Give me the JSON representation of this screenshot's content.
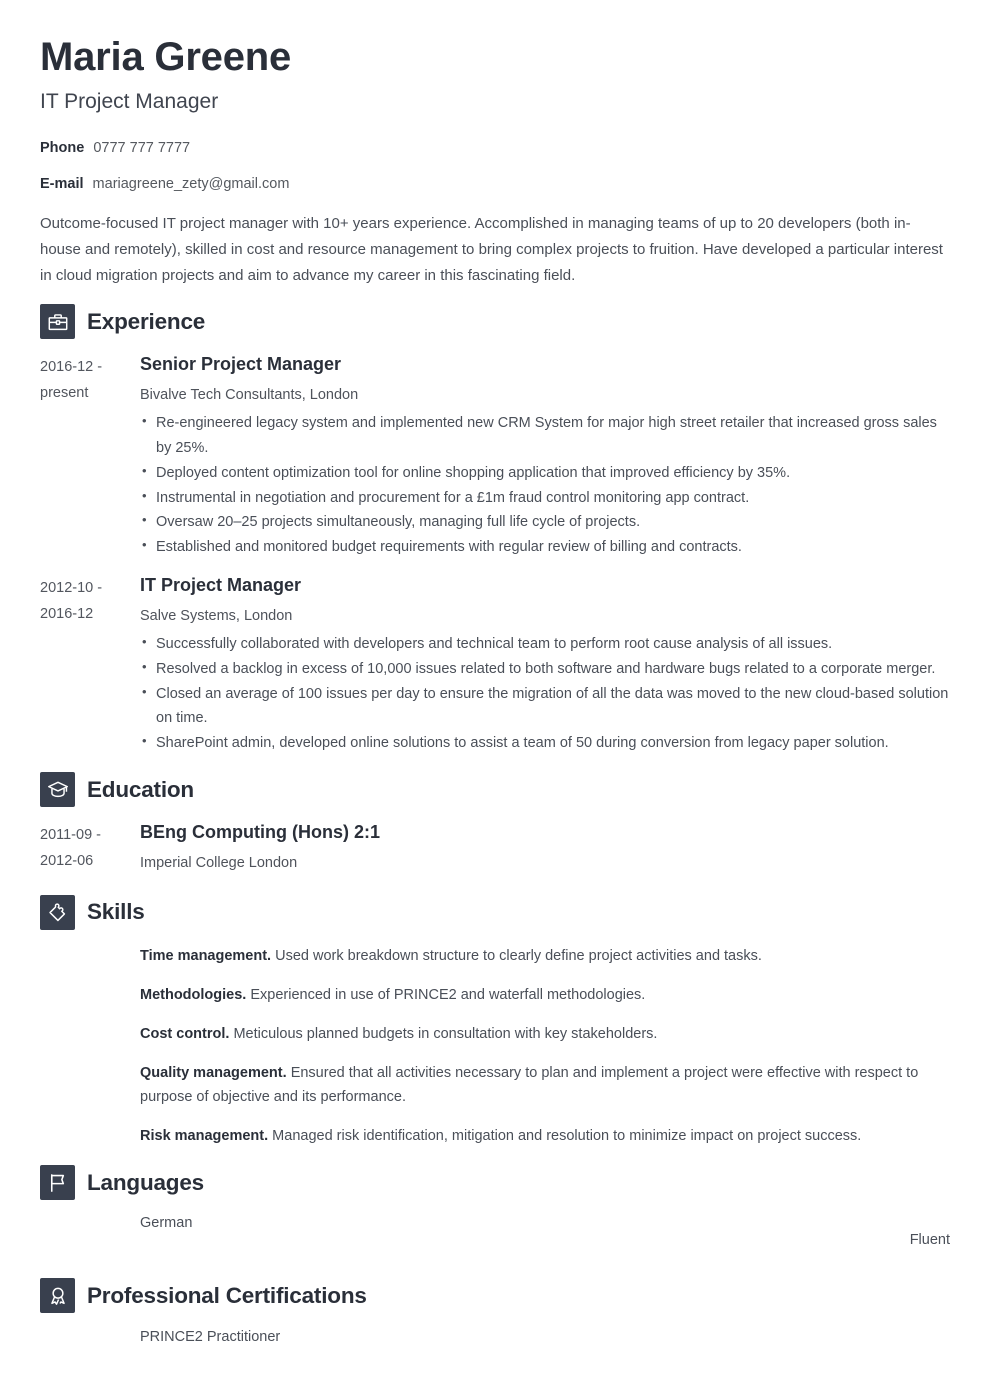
{
  "header": {
    "full_name": "Maria Greene",
    "job_title": "IT Project Manager",
    "contacts": [
      {
        "label": "Phone",
        "value": "0777 777 7777"
      },
      {
        "label": "E-mail",
        "value": "mariagreene_zety@gmail.com"
      }
    ]
  },
  "summary": "Outcome-focused IT project manager with 10+ years experience. Accomplished in managing teams of up to 20 developers (both in-house and remotely), skilled in cost and resource management to bring complex projects to fruition. Have developed a particular interest in cloud migration projects and aim to advance my career in this fascinating field.",
  "sections": {
    "experience": {
      "title": "Experience",
      "icon": "briefcase-icon",
      "entries": [
        {
          "dates": "2016-12 - present",
          "title": "Senior Project Manager",
          "subtitle": "Bivalve Tech Consultants, London",
          "bullets": [
            "Re-engineered legacy system and implemented new CRM System for major high street retailer that increased gross sales by 25%.",
            "Deployed content optimization tool for online shopping application that improved efficiency by 35%.",
            "Instrumental in negotiation and procurement for a £1m fraud control monitoring app contract.",
            "Oversaw 20–25 projects simultaneously, managing full life cycle of projects.",
            "Established and monitored budget requirements with regular review of billing and contracts."
          ]
        },
        {
          "dates": "2012-10 - 2016-12",
          "title": "IT Project Manager",
          "subtitle": "Salve Systems, London",
          "bullets": [
            "Successfully collaborated with developers and technical team to perform root cause analysis of all issues.",
            "Resolved a backlog in excess of 10,000 issues related to both software and hardware bugs related to a corporate merger.",
            "Closed an average of 100 issues per day to ensure the migration of all the data was moved to the new cloud-based solution on time.",
            "SharePoint admin, developed online solutions to assist a team of 50 during conversion from legacy paper solution."
          ]
        }
      ]
    },
    "education": {
      "title": "Education",
      "icon": "graduation-cap-icon",
      "entries": [
        {
          "dates": "2011-09 - 2012-06",
          "title": "BEng Computing (Hons) 2:1",
          "subtitle": "Imperial College London"
        }
      ]
    },
    "skills": {
      "title": "Skills",
      "icon": "puzzle-piece-icon",
      "items": [
        {
          "name": "Time management.",
          "description": "Used work breakdown structure to clearly define project activities and tasks."
        },
        {
          "name": "Methodologies.",
          "description": "Experienced in use of PRINCE2 and waterfall methodologies."
        },
        {
          "name": "Cost control.",
          "description": "Meticulous planned budgets in consultation with key stakeholders."
        },
        {
          "name": "Quality management.",
          "description": "Ensured that all activities necessary to plan and implement a project were effective with respect to purpose of objective and its performance."
        },
        {
          "name": "Risk management.",
          "description": "Managed risk identification, mitigation and resolution to minimize impact on project success."
        }
      ]
    },
    "languages": {
      "title": "Languages",
      "icon": "flag-icon",
      "items": [
        {
          "name": "German",
          "level": "Fluent",
          "level_percent": 100
        }
      ]
    },
    "certifications": {
      "title": "Professional Certifications",
      "icon": "award-ribbon-icon",
      "items": [
        {
          "name": "PRINCE2 Practitioner"
        }
      ]
    }
  },
  "theme": {
    "accent": "#39404e",
    "heading_color": "#2a2f39",
    "body_color": "#4a4f58",
    "page_background": "#ffffff"
  }
}
